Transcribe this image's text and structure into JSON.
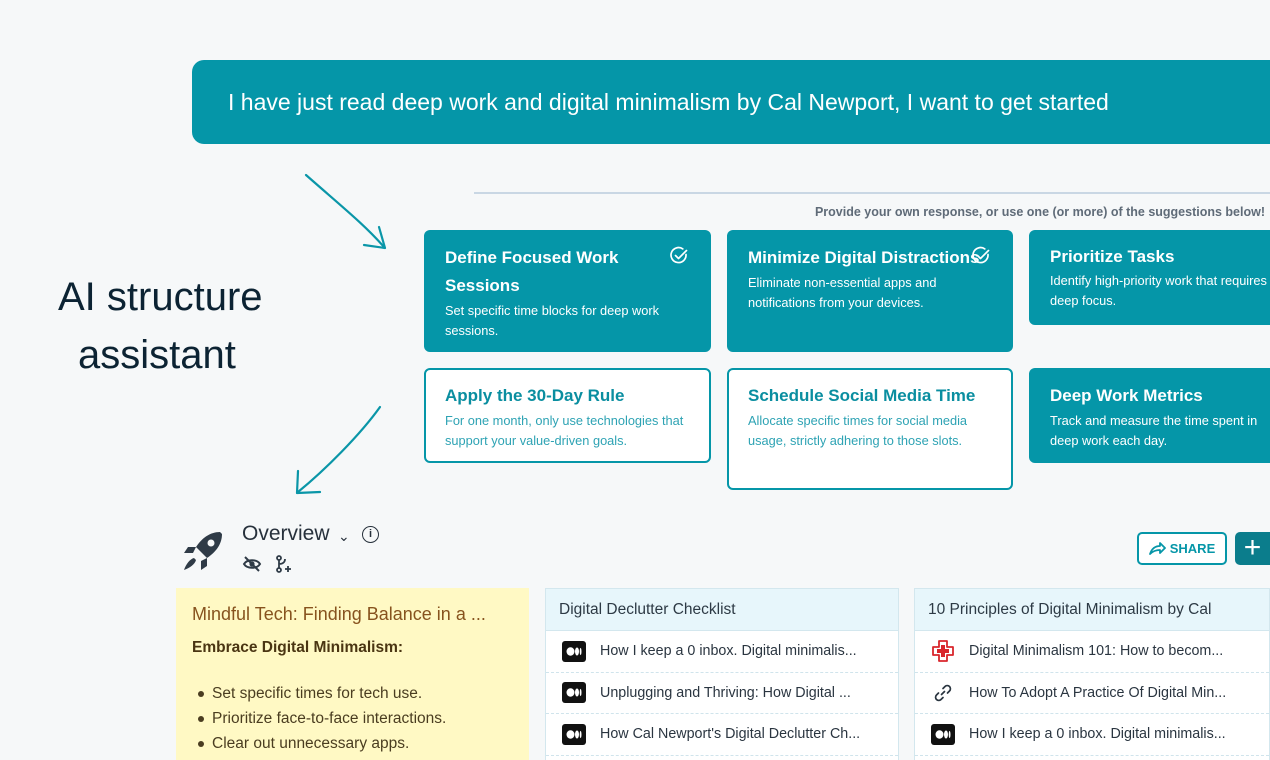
{
  "prompt": {
    "text": "I have just read deep work and digital minimalism by Cal Newport, I want to get started"
  },
  "suggestions": {
    "hint": "Provide your own response, or use one (or more) of the suggestions below!",
    "cards": [
      {
        "title": "Define Focused Work Sessions",
        "description": "Set specific time blocks for deep work sessions.",
        "selected": true
      },
      {
        "title": "Minimize Digital Distractions",
        "description": "Eliminate non-essential apps and notifications from your devices.",
        "selected": true
      },
      {
        "title": "Prioritize Tasks",
        "description": "Identify high-priority work that requires deep focus.",
        "selected": false
      },
      {
        "title": "Apply the 30-Day Rule",
        "description": "For one month, only use technologies that support your value-driven goals.",
        "selected": false
      },
      {
        "title": "Schedule Social Media Time",
        "description": "Allocate specific times for social media usage, strictly adhering to those slots.",
        "selected": false
      },
      {
        "title": "Deep Work Metrics",
        "description": "Track and measure the time spent in deep work each day.",
        "selected": false
      }
    ]
  },
  "annotation": {
    "line1": "AI structure",
    "line2": "assistant"
  },
  "overview": {
    "title": "Overview",
    "share_label": "SHARE",
    "plus_label": "+"
  },
  "note": {
    "title": "Mindful Tech: Finding Balance in a ...",
    "subtitle": "Embrace Digital Minimalism:",
    "bullets": [
      "Set specific times for tech use.",
      "Prioritize face-to-face interactions.",
      "Clear out unnecessary apps."
    ]
  },
  "panels": [
    {
      "title": "Digital Declutter Checklist",
      "items": [
        {
          "icon": "medium-icon",
          "label": "How I keep a 0 inbox. Digital minimalis..."
        },
        {
          "icon": "medium-icon",
          "label": "Unplugging and Thriving: How Digital ..."
        },
        {
          "icon": "medium-icon",
          "label": "How Cal Newport's Digital Declutter Ch..."
        }
      ]
    },
    {
      "title": "10 Principles of Digital Minimalism by Cal",
      "items": [
        {
          "icon": "cross-site-icon",
          "label": "Digital Minimalism 101: How to becom..."
        },
        {
          "icon": "link-icon",
          "label": "How To Adopt A Practice Of Digital Min..."
        },
        {
          "icon": "medium-icon",
          "label": "How I keep a 0 inbox. Digital minimalis..."
        }
      ]
    }
  ],
  "colors": {
    "accent": "#0596a8",
    "note_bg": "#fff9c4",
    "panel_head": "#e7f6fb"
  }
}
